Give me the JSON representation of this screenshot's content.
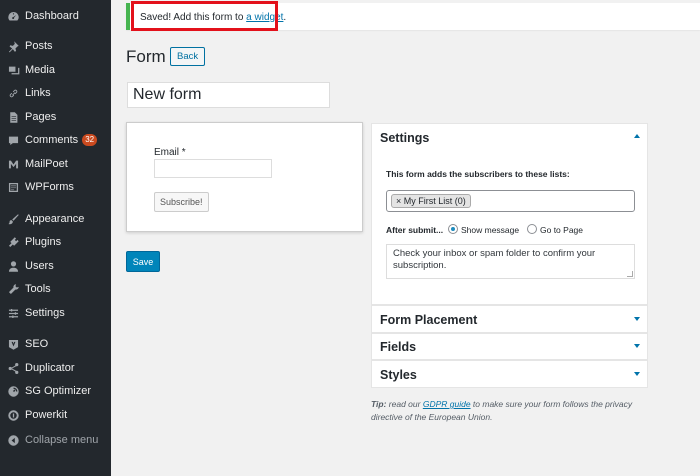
{
  "sidebar": {
    "items": [
      {
        "label": "Dashboard",
        "icon": "dashboard-icon"
      },
      {
        "label": "Posts",
        "icon": "pin-icon"
      },
      {
        "label": "Media",
        "icon": "media-icon"
      },
      {
        "label": "Links",
        "icon": "link-icon"
      },
      {
        "label": "Pages",
        "icon": "page-icon"
      },
      {
        "label": "Comments",
        "icon": "comment-icon",
        "badge": "32"
      },
      {
        "label": "MailPoet",
        "icon": "mailpoet-icon"
      },
      {
        "label": "WPForms",
        "icon": "forms-icon"
      },
      {
        "label": "Appearance",
        "icon": "brush-icon"
      },
      {
        "label": "Plugins",
        "icon": "plugin-icon"
      },
      {
        "label": "Users",
        "icon": "user-icon"
      },
      {
        "label": "Tools",
        "icon": "wrench-icon"
      },
      {
        "label": "Settings",
        "icon": "settings-icon"
      },
      {
        "label": "SEO",
        "icon": "seo-icon"
      },
      {
        "label": "Duplicator",
        "icon": "share-icon"
      },
      {
        "label": "SG Optimizer",
        "icon": "optimizer-icon"
      },
      {
        "label": "Powerkit",
        "icon": "power-icon"
      },
      {
        "label": "Collapse menu",
        "icon": "collapse-icon"
      }
    ]
  },
  "notice": {
    "text_before": "Saved! Add this form to ",
    "link": "a widget",
    "text_after": "."
  },
  "page": {
    "title": "Form",
    "back_label": "Back",
    "form_name": "New form"
  },
  "preview": {
    "email_label": "Email *",
    "subscribe_label": "Subscribe!"
  },
  "save_label": "Save",
  "settings": {
    "title": "Settings",
    "description": "This form adds the subscribers to these lists:",
    "list_token": "My First List (0)",
    "token_remove": "×",
    "after_submit_label": "After submit...",
    "option_show_message": "Show message",
    "option_go_to_page": "Go to Page",
    "message": "Check your inbox or spam folder to confirm your subscription."
  },
  "panels": {
    "form_placement": "Form Placement",
    "fields": "Fields",
    "styles": "Styles"
  },
  "tip": {
    "label": "Tip:",
    "text_before": " read our ",
    "link": "GDPR guide",
    "text_after": " to make sure your form follows the privacy directive of the European Union."
  },
  "colors": {
    "sidebar_bg": "#23282d",
    "accent": "#0085ba",
    "notice_success": "#46b450",
    "highlight": "#e3111b",
    "badge": "#ca4a1f"
  }
}
